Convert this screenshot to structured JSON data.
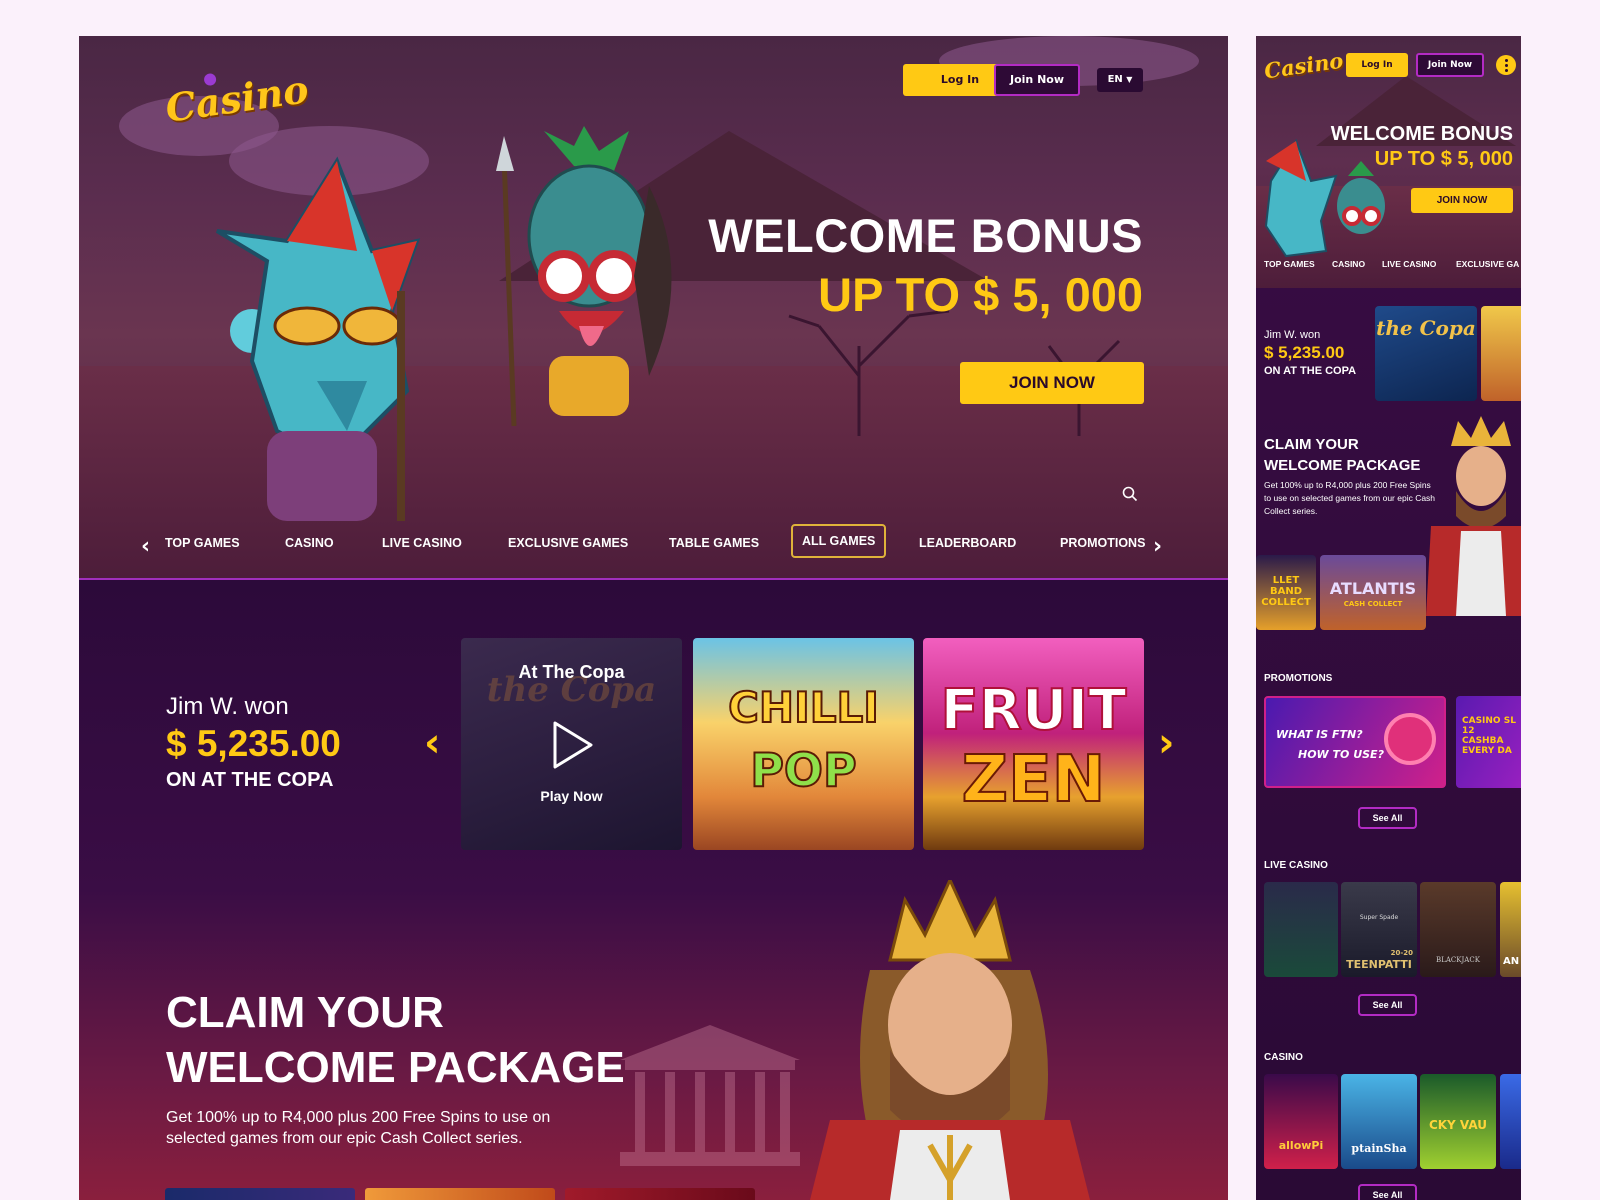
{
  "brand": {
    "logo_text": "Casino"
  },
  "header": {
    "login_label": "Log In",
    "join_label": "Join Now",
    "lang_label": "EN"
  },
  "hero": {
    "title_line1": "WELCOME BONUS",
    "title_line2": "UP TO $ 5, 000",
    "cta_label": "JOIN NOW"
  },
  "nav": {
    "items": [
      "TOP GAMES",
      "CASINO",
      "LIVE CASINO",
      "EXCLUSIVE GAMES",
      "TABLE GAMES",
      "ALL GAMES",
      "LEADERBOARD",
      "PROMOTIONS"
    ],
    "active": "ALL GAMES"
  },
  "winner": {
    "name": "Jim W. won",
    "amount": "$ 5,235.00",
    "game": "ON AT THE COPA"
  },
  "games": [
    {
      "title": "At The Copa",
      "action": "Play Now"
    },
    {
      "title_line1": "CHILLI",
      "title_line2": "POP"
    },
    {
      "title_line1": "FRUIT",
      "title_line2": "ZEN"
    }
  ],
  "claim": {
    "title_line1": "CLAIM YOUR",
    "title_line2": "WELCOME PACKAGE",
    "body": "Get 100% up to R4,000 plus 200 Free Spins to use on selected games from our epic Cash Collect series."
  },
  "mobile": {
    "logo_text": "Casino",
    "login_label": "Log In",
    "join_label": "Join Now",
    "hero_title_line1": "WELCOME BONUS",
    "hero_title_line2": "UP TO $ 5, 000",
    "hero_cta": "JOIN NOW",
    "nav": [
      "TOP GAMES",
      "CASINO",
      "LIVE CASINO",
      "EXCLUSIVE GA"
    ],
    "winner_name": "Jim W. won",
    "winner_amount": "$ 5,235.00",
    "winner_game": "ON AT THE COPA",
    "copa_tile": "the Copa",
    "claim_title_line1": "CLAIM YOUR",
    "claim_title_line2": "WELCOME PACKAGE",
    "claim_body": "Get 100% up to R4,000 plus 200 Free Spins to use on selected games from our epic Cash Collect series.",
    "cash_tile_1": "LLET BAND COLLECT",
    "cash_tile_2": "ATLANTIS",
    "cash_tile_2_sub": "CASH COLLECT",
    "promotions_title": "PROMOTIONS",
    "promo_1_line1": "WHAT IS FTN?",
    "promo_1_line2": "HOW TO USE?",
    "promo_2": "CASINO SL 12 CASHBA EVERY DA",
    "live_casino_title": "LIVE CASINO",
    "live_2_top": "Super Spade",
    "live_2_bottom": "TEENPATTI",
    "live_2_num": "20-20",
    "live_3": "BLACKJACK",
    "live_4": "AN",
    "casino_title": "CASINO",
    "casino_2": "ptainSha",
    "casino_3": "CKY VAU",
    "casino_1": "allowPi",
    "see_all": "See All"
  }
}
